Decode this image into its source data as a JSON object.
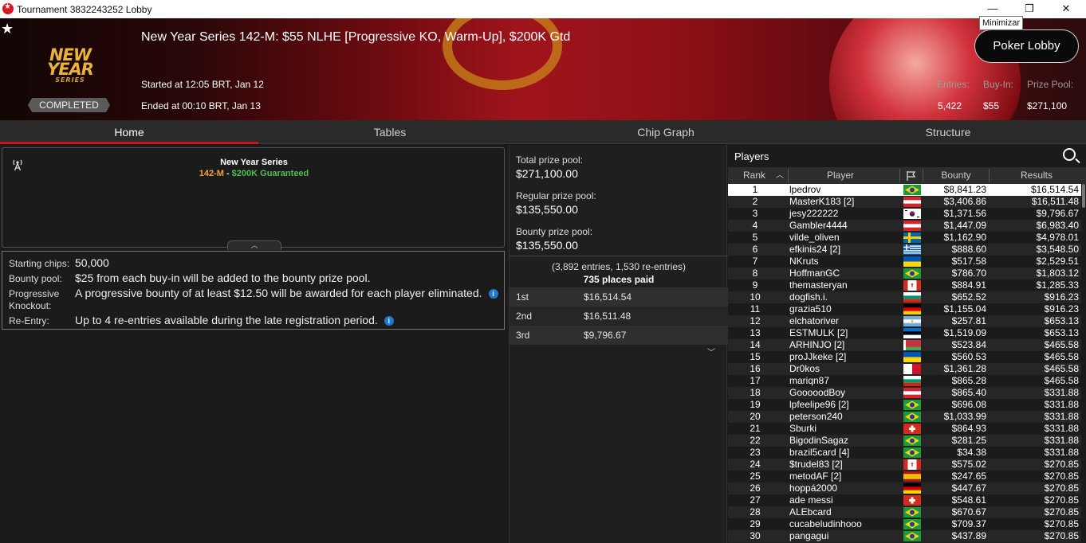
{
  "window": {
    "title": "Tournament 3832243252 Lobby",
    "tooltip": "Minimizar",
    "minimize_glyph": "—",
    "maximize_glyph": "❐",
    "close_glyph": "✕"
  },
  "banner": {
    "brand_main": "NEW YEAR",
    "brand_sub": "SERIES",
    "status": "COMPLETED",
    "tournament_title": "New Year Series 142-M: $55 NLHE [Progressive KO, Warm-Up], $200K Gtd",
    "started": "Started at 12:05 BRT, Jan 12",
    "ended": "Ended at 00:10 BRT, Jan 13",
    "lobby_button": "Poker Lobby",
    "stats": {
      "entries_label": "Entries:",
      "entries_value": "5,422",
      "buyin_label": "Buy-In:",
      "buyin_value": "$55",
      "prizepool_label": "Prize Pool:",
      "prizepool_value": "$271,100"
    }
  },
  "tabs": [
    "Home",
    "Tables",
    "Chip Graph",
    "Structure"
  ],
  "series_box": {
    "name": "New Year Series",
    "code": "142-M",
    "separator": " - ",
    "guarantee": "$200K Guaranteed"
  },
  "info": {
    "starting_chips_label": "Starting chips:",
    "starting_chips_value": "50,000",
    "bounty_pool_label": "Bounty pool:",
    "bounty_pool_value": "$25 from each buy-in will be added to the bounty prize pool.",
    "pko_label": "Progressive Knockout:",
    "pko_value": "A progressive bounty of at least $12.50 will be awarded for each player eliminated.",
    "reentry_label": "Re-Entry:",
    "reentry_value": "Up to 4 re-entries available during the late registration period.",
    "info_glyph": "i"
  },
  "prizes": {
    "total_label": "Total prize pool:",
    "total_value": "$271,100.00",
    "regular_label": "Regular prize pool:",
    "regular_value": "$135,550.00",
    "bounty_label": "Bounty prize pool:",
    "bounty_value": "$135,550.00",
    "entries_line": "(3,892 entries, 1,530 re-entries)",
    "places_line": "735 places paid",
    "payouts": [
      {
        "place": "1st",
        "amount": "$16,514.54"
      },
      {
        "place": "2nd",
        "amount": "$16,511.48"
      },
      {
        "place": "3rd",
        "amount": "$9,796.67"
      }
    ]
  },
  "players": {
    "title": "Players",
    "columns": {
      "rank": "Rank",
      "player": "Player",
      "bounty": "Bounty",
      "results": "Results"
    },
    "colors": {
      "accent": "#c8141c",
      "selected_row": "#ffffff"
    },
    "rows": [
      {
        "rank": "1",
        "name": "lpedrov",
        "flag": "brazil",
        "bounty": "$8,841.23",
        "result": "$16,514.54"
      },
      {
        "rank": "2",
        "name": "MasterK183 [2]",
        "flag": "austria",
        "bounty": "$3,406.86",
        "result": "$16,511.48"
      },
      {
        "rank": "3",
        "name": "jesy222222",
        "flag": "south-korea",
        "bounty": "$1,371.56",
        "result": "$9,796.67"
      },
      {
        "rank": "4",
        "name": "Gambler4444",
        "flag": "austria",
        "bounty": "$1,447.09",
        "result": "$6,983.40"
      },
      {
        "rank": "5",
        "name": "vilde_oliven",
        "flag": "sweden",
        "bounty": "$1,162.90",
        "result": "$4,978.01"
      },
      {
        "rank": "6",
        "name": "efkinis24 [2]",
        "flag": "greece",
        "bounty": "$888.60",
        "result": "$3,548.50"
      },
      {
        "rank": "7",
        "name": "NKruts",
        "flag": "ukraine",
        "bounty": "$517.58",
        "result": "$2,529.51"
      },
      {
        "rank": "8",
        "name": "HoffmanGC",
        "flag": "brazil",
        "bounty": "$786.70",
        "result": "$1,803.12"
      },
      {
        "rank": "9",
        "name": "themasteryan",
        "flag": "canada",
        "bounty": "$884.91",
        "result": "$1,285.33"
      },
      {
        "rank": "10",
        "name": "dogfish.i.",
        "flag": "bulgaria",
        "bounty": "$652.52",
        "result": "$916.23"
      },
      {
        "rank": "11",
        "name": "grazia510",
        "flag": "germany",
        "bounty": "$1,155.04",
        "result": "$916.23"
      },
      {
        "rank": "12",
        "name": "elchatoriver",
        "flag": "argentina",
        "bounty": "$257.81",
        "result": "$653.13"
      },
      {
        "rank": "13",
        "name": "ESTMULK [2]",
        "flag": "estonia",
        "bounty": "$1,519.09",
        "result": "$653.13"
      },
      {
        "rank": "14",
        "name": "ARHINJO [2]",
        "flag": "belarus",
        "bounty": "$523.84",
        "result": "$465.58"
      },
      {
        "rank": "15",
        "name": "proJJkeke [2]",
        "flag": "ukraine",
        "bounty": "$560.53",
        "result": "$465.58"
      },
      {
        "rank": "16",
        "name": "Dr0kos",
        "flag": "malta",
        "bounty": "$1,361.28",
        "result": "$465.58"
      },
      {
        "rank": "17",
        "name": "mariqn87",
        "flag": "bulgaria",
        "bounty": "$865.28",
        "result": "$465.58"
      },
      {
        "rank": "18",
        "name": "GooooodBoy",
        "flag": "austria",
        "bounty": "$865.40",
        "result": "$331.88"
      },
      {
        "rank": "19",
        "name": "lpfeelipe96 [2]",
        "flag": "brazil",
        "bounty": "$696.08",
        "result": "$331.88"
      },
      {
        "rank": "20",
        "name": "peterson240",
        "flag": "brazil",
        "bounty": "$1,033.99",
        "result": "$331.88"
      },
      {
        "rank": "21",
        "name": "Sburki",
        "flag": "switzerland",
        "bounty": "$864.93",
        "result": "$331.88"
      },
      {
        "rank": "22",
        "name": "BigodinSagaz",
        "flag": "brazil",
        "bounty": "$281.25",
        "result": "$331.88"
      },
      {
        "rank": "23",
        "name": "brazil5card [4]",
        "flag": "brazil",
        "bounty": "$34.38",
        "result": "$331.88"
      },
      {
        "rank": "24",
        "name": "$trudel83 [2]",
        "flag": "canada",
        "bounty": "$575.02",
        "result": "$270.85"
      },
      {
        "rank": "25",
        "name": "metodAF [2]",
        "flag": "spain",
        "bounty": "$247.65",
        "result": "$270.85"
      },
      {
        "rank": "26",
        "name": "hoppá2000",
        "flag": "germany",
        "bounty": "$447.67",
        "result": "$270.85"
      },
      {
        "rank": "27",
        "name": "ade messi",
        "flag": "switzerland",
        "bounty": "$548.61",
        "result": "$270.85"
      },
      {
        "rank": "28",
        "name": "ALEbcard",
        "flag": "brazil",
        "bounty": "$670.67",
        "result": "$270.85"
      },
      {
        "rank": "29",
        "name": "cucabeludinhooo",
        "flag": "brazil",
        "bounty": "$709.37",
        "result": "$270.85"
      },
      {
        "rank": "30",
        "name": "pangagui",
        "flag": "brazil",
        "bounty": "$437.89",
        "result": "$270.85"
      }
    ]
  }
}
